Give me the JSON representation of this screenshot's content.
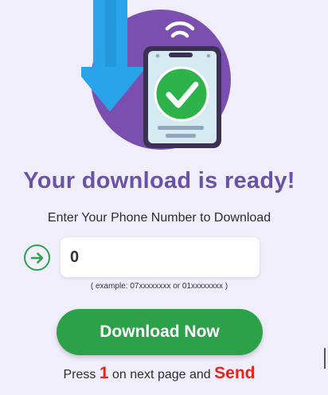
{
  "hero": {
    "illustration": "download-phone-check-illustration"
  },
  "heading": "Your download is ready!",
  "subheading": "Enter Your Phone Number to Download",
  "phone_field": {
    "value": "0",
    "icon": "arrow-right-circle-icon"
  },
  "example_hint": "( example: 07xxxxxxxx or 01xxxxxxxx )",
  "download_button": "Download Now",
  "instruction": {
    "prefix": "Press",
    "key": "1",
    "middle": "on next page and",
    "action": "Send"
  },
  "colors": {
    "background": "#f1eefb",
    "heading": "#6a53a6",
    "button": "#2da14a",
    "highlight": "#e8231b"
  }
}
